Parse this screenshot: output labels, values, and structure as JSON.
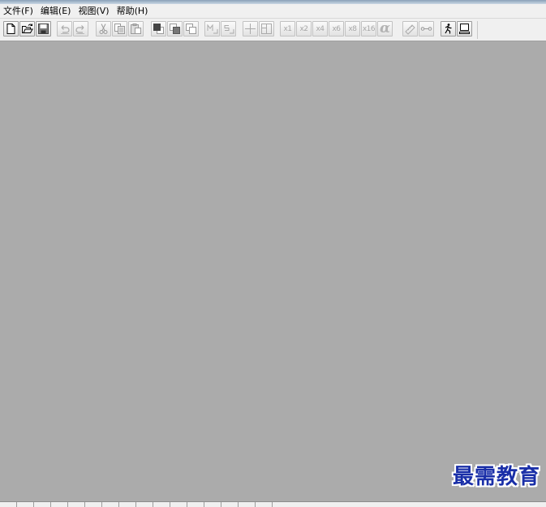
{
  "menubar": {
    "file": "文件(F)",
    "edit": "编辑(E)",
    "view": "视图(V)",
    "help": "帮助(H)"
  },
  "toolbar": {
    "zoom_x1": "x1",
    "zoom_x2": "x2",
    "zoom_x4": "x4",
    "zoom_x6": "x6",
    "zoom_x8": "x8",
    "zoom_x16": "x16",
    "alpha": "α"
  },
  "icons": {
    "new": "new-document-icon",
    "open": "open-folder-icon",
    "save": "save-disk-icon",
    "undo": "undo-icon",
    "redo": "redo-icon",
    "cut": "scissors-icon",
    "copy": "copy-icon",
    "paste": "paste-icon",
    "measure": "ruler-icon",
    "connect": "connector-icon",
    "run": "running-figure-icon",
    "preview": "monitor-icon"
  },
  "colors": {
    "workspace": "#ababab",
    "chrome": "#f0f0f0",
    "watermark": "#1a2fa8"
  },
  "watermark": "最需教育"
}
